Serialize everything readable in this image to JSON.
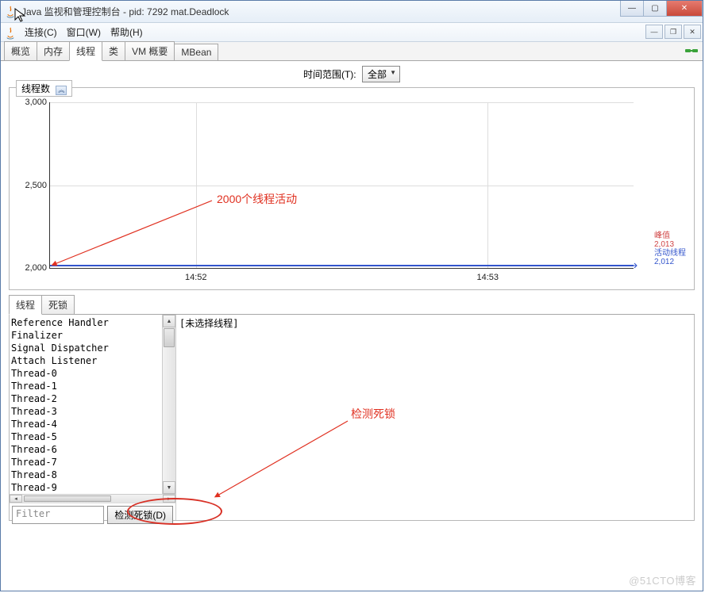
{
  "window": {
    "title": "Java 监视和管理控制台 - pid: 7292 mat.Deadlock"
  },
  "menu": {
    "connect": "连接(C)",
    "window": "窗口(W)",
    "help": "帮助(H)"
  },
  "tabs": {
    "overview": "概览",
    "memory": "内存",
    "threads": "线程",
    "classes": "类",
    "vmsummary": "VM 概要",
    "mbean": "MBean"
  },
  "range": {
    "label": "时间范围(T):",
    "value": "全部"
  },
  "chart": {
    "panel_label": "线程数"
  },
  "chart_data": {
    "type": "line",
    "title": "线程数",
    "ylabel": "",
    "xlabel": "",
    "ylim": [
      2000,
      3000
    ],
    "yticks": [
      "3,000",
      "2,500",
      "2,000"
    ],
    "xticks": [
      "14:52",
      "14:53"
    ],
    "series": [
      {
        "name": "活动线程",
        "color": "#3355cc",
        "values": [
          2012,
          2012,
          2012,
          2012
        ]
      }
    ],
    "x": [
      "14:51:30",
      "14:52:00",
      "14:52:30",
      "14:53:00"
    ],
    "legend": {
      "peak_label": "峰值",
      "peak_value": "2,013",
      "live_label": "活动线程",
      "live_value": "2,012"
    }
  },
  "annotation": {
    "chart": "2000个线程活动",
    "detect": "检测死锁"
  },
  "lower_tabs": {
    "threads": "线程",
    "deadlock": "死锁"
  },
  "thread_list": [
    "Reference Handler",
    "Finalizer",
    "Signal Dispatcher",
    "Attach Listener",
    "Thread-0",
    "Thread-1",
    "Thread-2",
    "Thread-3",
    "Thread-4",
    "Thread-5",
    "Thread-6",
    "Thread-7",
    "Thread-8",
    "Thread-9"
  ],
  "detail": {
    "placeholder": "[未选择线程]"
  },
  "filter": {
    "placeholder": "Filter"
  },
  "buttons": {
    "detect_deadlock": "检测死锁(D)"
  },
  "watermark": "@51CTO博客"
}
